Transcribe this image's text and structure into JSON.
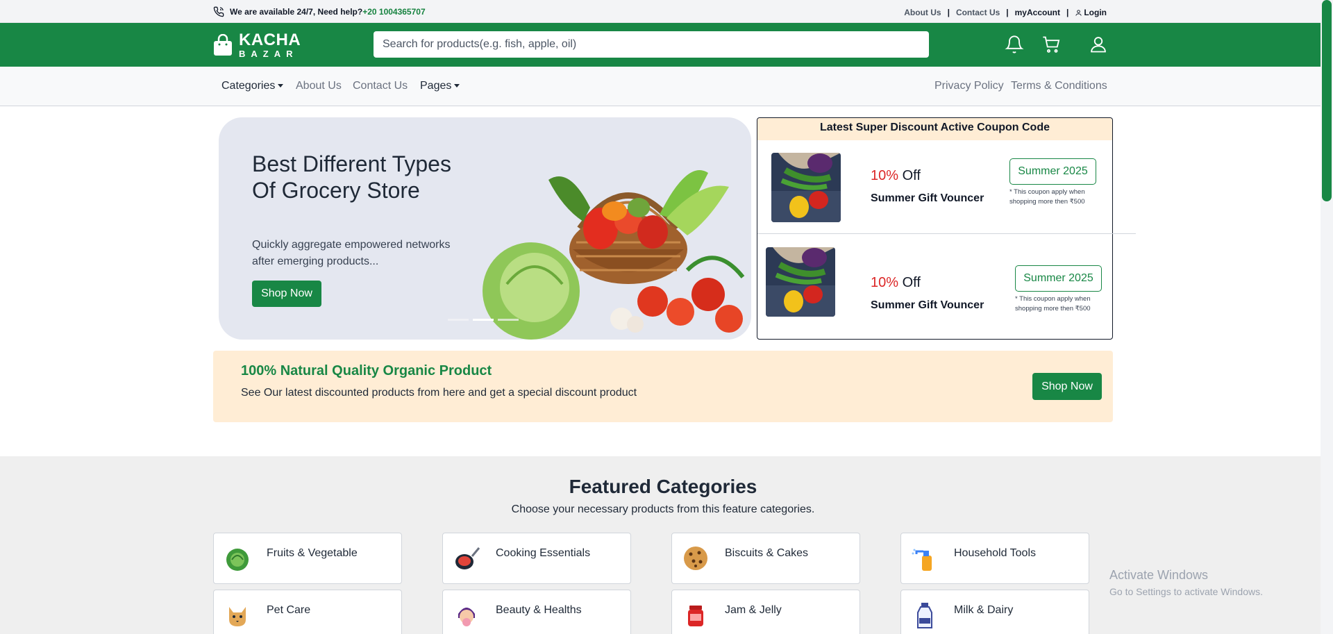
{
  "topbar": {
    "availability": "We are available 24/7, Need help?",
    "phone": "+20 1004365707",
    "links": [
      "About Us",
      "Contact Us",
      "myAccount",
      "Login"
    ],
    "separator": "|"
  },
  "header": {
    "logo_line1": "KACHA",
    "logo_line2": "BAZAR",
    "search_placeholder": "Search for products(e.g. fish, apple, oil)",
    "icons": [
      "bell-icon",
      "cart-icon",
      "user-icon"
    ]
  },
  "nav": {
    "left": [
      "Categories",
      "About Us",
      "Contact Us",
      "Pages"
    ],
    "right": [
      "Privacy Policy",
      "Terms & Conditions"
    ]
  },
  "hero": {
    "title": "Best Different Types Of Grocery Store",
    "text": "Quickly aggregate empowered networks after emerging products...",
    "button": "Shop Now",
    "slides": 3,
    "active_slide": 2
  },
  "coupons": {
    "title": "Latest Super Discount Active Coupon Code",
    "items": [
      {
        "percent": "10%",
        "off": "Off",
        "name": "Summer Gift Vouncer",
        "code": "Summer 2025",
        "note": "* This coupon apply when shopping more then ₹500"
      },
      {
        "percent": "10%",
        "off": "Off",
        "name": "Summer Gift Vouncer",
        "code": "Summer 2025",
        "note": "* This coupon apply when shopping more then ₹500"
      }
    ]
  },
  "organic": {
    "title": "100% Natural Quality Organic Product",
    "text": "See Our latest discounted products from here and get a special discount product",
    "button": "Shop Now"
  },
  "featured": {
    "title": "Featured Categories",
    "subtitle": "Choose your necessary products from this feature categories.",
    "categories": [
      {
        "label": "Fruits & Vegetable",
        "icon": "cabbage-icon"
      },
      {
        "label": "Cooking Essentials",
        "icon": "frying-pan-icon"
      },
      {
        "label": "Biscuits & Cakes",
        "icon": "cookie-icon"
      },
      {
        "label": "Household Tools",
        "icon": "spray-bottle-icon"
      },
      {
        "label": "Pet Care",
        "icon": "cat-icon"
      },
      {
        "label": "Beauty & Healths",
        "icon": "beauty-face-icon"
      },
      {
        "label": "Jam & Jelly",
        "icon": "jam-jar-icon"
      },
      {
        "label": "Milk & Dairy",
        "icon": "milk-bottle-icon"
      }
    ]
  },
  "watermark": {
    "line1": "Activate Windows",
    "line2": "Go to Settings to activate Windows."
  },
  "colors": {
    "brand_green": "#188745",
    "discount_red": "#dc2626",
    "cream": "#ffedd5"
  }
}
